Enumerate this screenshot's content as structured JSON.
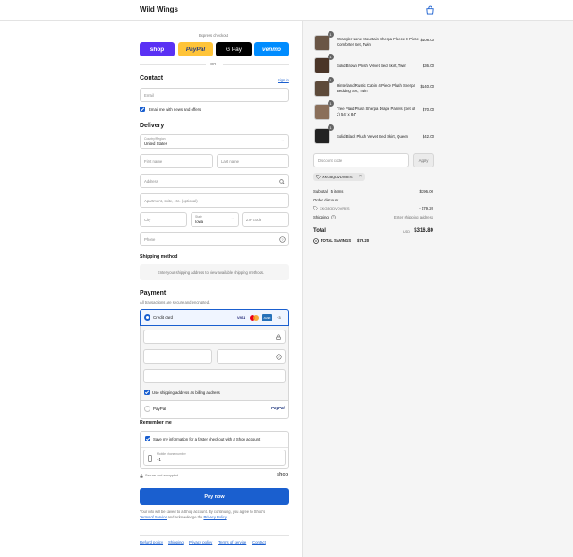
{
  "header": {
    "brand": "Wild Wings",
    "cart_icon": "shopping-bag-icon",
    "accent": "#1a5fcf"
  },
  "express": {
    "label": "Express checkout",
    "or": "OR",
    "buttons": [
      "shop",
      "PayPal",
      "G Pay",
      "venmo"
    ]
  },
  "contact": {
    "title": "Contact",
    "sign_in": "Sign in",
    "email_placeholder": "Email",
    "news_label": "Email me with news and offers"
  },
  "delivery": {
    "title": "Delivery",
    "country_label": "Country/Region",
    "country_value": "United States",
    "first_name": "First name",
    "last_name": "Last name",
    "address": "Address",
    "apartment": "Apartment, suite, etc. (optional)",
    "city": "City",
    "state_label": "State",
    "state_value": "Iowa",
    "zip": "ZIP code",
    "phone": "Phone"
  },
  "shipping_method": {
    "title": "Shipping method",
    "note": "Enter your shipping address to view available shipping methods."
  },
  "payment": {
    "title": "Payment",
    "subtitle": "All transactions are secure and encrypted.",
    "credit_card": "Credit card",
    "brands": [
      "VISA",
      "MC",
      "AMEX",
      "+3"
    ],
    "billing_label": "Use shipping address as billing address",
    "paypal": "PayPal",
    "paypal_logo": "PayPal"
  },
  "remember": {
    "title": "Remember me",
    "save_label": "Save my information for a faster checkout with a Shop account",
    "phone_label": "Mobile phone number",
    "phone_value": "+1",
    "secure": "Secure and encrypted",
    "shop_logo": "shop"
  },
  "pay_now": "Pay now",
  "terms": {
    "line1": "Your info will be saved to a Shop account. By continuing, you agree to Shop's",
    "terms_link": "Terms of Service",
    "and": " and acknowledge the ",
    "privacy_link": "Privacy Policy",
    "end": "."
  },
  "footer": [
    "Refund policy",
    "Shipping",
    "Privacy policy",
    "Terms of service",
    "Contact"
  ],
  "cart": {
    "items": [
      {
        "qty": "1",
        "name": "Wrangler Lone Mountain Sherpa Fleece 3-Piece Comforter Set, Twin",
        "price": "$108.00"
      },
      {
        "qty": "1",
        "name": "Solid Brown Plush Velvet Bed Skirt, Twin",
        "price": "$36.00"
      },
      {
        "qty": "1",
        "name": "Hinterland Rustic Cabin 4-Piece Plush Sherpa Bedding Set, Twin",
        "price": "$140.00"
      },
      {
        "qty": "1",
        "name": "Tree Plaid Plush Sherpa Drape Panels (Set of 2) 54\" x 84\"",
        "price": "$70.00"
      },
      {
        "qty": "1",
        "name": "Solid Black Plush Velvet Bed Skirt, Queen",
        "price": "$42.00"
      }
    ],
    "discount_placeholder": "Discount code",
    "apply": "Apply",
    "applied_code": "XKGBQDVDVRES",
    "subtotal_label": "Subtotal · 5 items",
    "subtotal": "$396.00",
    "order_discount": "Order discount",
    "code_label": "XKGBQDVDVRES",
    "discount": "- $79.20",
    "shipping_label": "Shipping",
    "shipping_value": "Enter shipping address",
    "total_label": "Total",
    "currency": "USD",
    "total": "$316.80",
    "savings_label": "TOTAL SAVINGS",
    "savings": "$79.20"
  }
}
